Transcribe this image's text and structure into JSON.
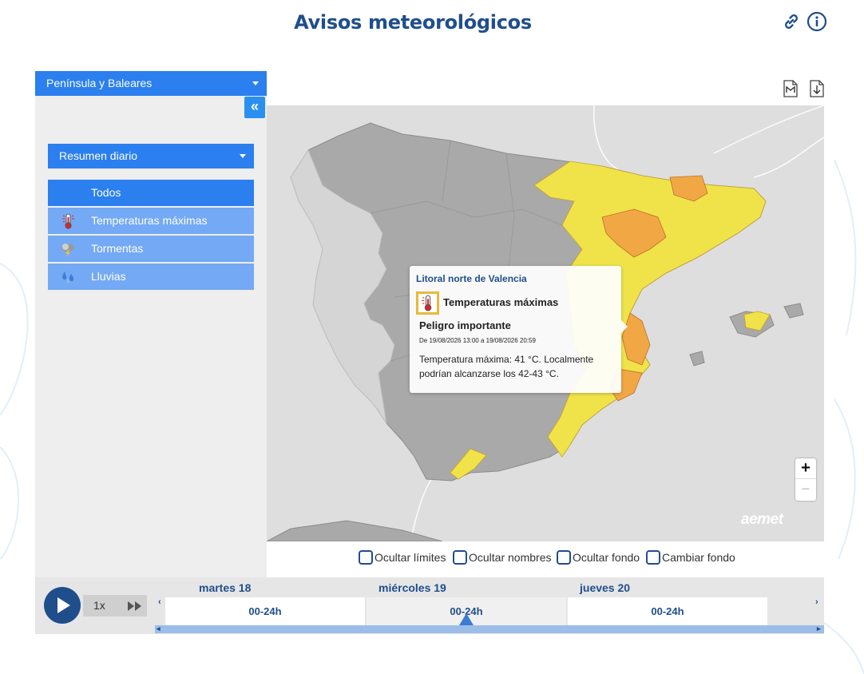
{
  "header": {
    "title": "Avisos meteorológicos"
  },
  "sidebar": {
    "region_select": "Península y Baleares",
    "collapse_glyph": "«",
    "view_select": "Resumen diario",
    "filters": [
      {
        "label": "Todos",
        "icon": "none",
        "active": true
      },
      {
        "label": "Temperaturas máximas",
        "icon": "thermometer-icon",
        "active": false
      },
      {
        "label": "Tormentas",
        "icon": "storm-icon",
        "active": false
      },
      {
        "label": "Lluvias",
        "icon": "rain-icon",
        "active": false
      }
    ]
  },
  "map": {
    "popup": {
      "zone": "Litoral norte de Valencia",
      "type": "Temperaturas máximas",
      "level": "Peligro importante",
      "dates": "De 19/08/2026 13:00 a 19/08/2026 20:59",
      "description": "Temperatura máxima: 41 °C. Localmente podrían alcanzarse los 42-43 °C."
    },
    "zoom_in": "+",
    "zoom_out": "−",
    "logo": "aemet",
    "colors": {
      "yellow": "#f0e34a",
      "orange": "#f2a745",
      "gray": "#a9a9a9",
      "sea": "#dedede"
    }
  },
  "options": [
    "Ocultar límites",
    "Ocultar nombres",
    "Ocultar fondo",
    "Cambiar fondo"
  ],
  "player": {
    "speed": "1x"
  },
  "timeline": {
    "days": [
      "martes 18",
      "miércoles 19",
      "jueves 20"
    ],
    "slots": [
      "00-24h",
      "00-24h",
      "00-24h"
    ],
    "selected_index": 1
  }
}
